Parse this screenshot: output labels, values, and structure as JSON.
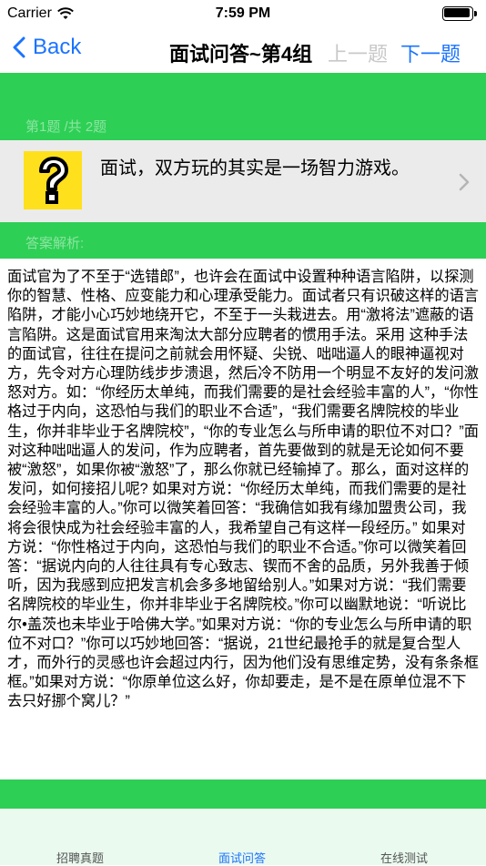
{
  "status": {
    "carrier": "Carrier",
    "time": "7:59 PM"
  },
  "nav": {
    "back_label": "Back",
    "title": "面试问答~第4组",
    "prev_label": "上一题",
    "next_label": "下一题"
  },
  "question": {
    "progress": "第1题 /共 2题",
    "text": "面试，双方玩的其实是一场智力游戏。",
    "icon": "question-mark-icon"
  },
  "answer": {
    "label": "答案解析:",
    "body": "面试官为了不至于“选错郎”，也许会在面试中设置种种语言陷阱，以探测你的智慧、性格、应变能力和心理承受能力。面试者只有识破这样的语言陷阱，才能小心巧妙地绕开它，不至于一头栽进去。用“激将法”遮蔽的语言陷阱。这是面试官用来淘汰大部分应聘者的惯用手法。采用 这种手法的面试官，往往在提问之前就会用怀疑、尖锐、咄咄逼人的眼神逼视对方，先令对方心理防线步步溃退，然后冷不防用一个明显不友好的发问激怒对方。如：“你经历太单纯，而我们需要的是社会经验丰富的人”，“你性格过于内向，这恐怕与我们的职业不合适”，“我们需要名牌院校的毕业生，你并非毕业于名牌院校”，“你的专业怎么与所申请的职位不对口？”面对这种咄咄逼人的发问，作为应聘者，首先要做到的就是无论如何不要被“激怒”，如果你被“激怒”了，那么你就已经输掉了。那么，面对这样的发问，如何接招儿呢? 如果对方说：“你经历太单纯，而我们需要的是社会经验丰富的人。”你可以微笑着回答：“我确信如我有缘加盟贵公司，我将会很快成为社会经验丰富的人，我希望自己有这样一段经历。” 如果对方说：“你性格过于内向，这恐怕与我们的职业不合适。”你可以微笑着回答：“据说内向的人往往具有专心致志、锲而不舍的品质，另外我善于倾听，因为我感到应把发言机会多多地留给别人。”如果对方说：“我们需要名牌院校的毕业生，你并非毕业于名牌院校。”你可以幽默地说：“听说比尔•盖茨也未毕业于哈佛大学。”如果对方说：“你的专业怎么与所申请的职位不对口？”你可以巧妙地回答：“据说，21世纪最抢手的就是复合型人才，而外行的灵感也许会超过内行，因为他们没有思维定势，没有条条框框。”如果对方说：“你原单位这么好，你却要走，是不是在原单位混不下去只好挪个窝儿？”"
  },
  "tabs": [
    {
      "label": "招聘真题",
      "active": false
    },
    {
      "label": "面试问答",
      "active": true
    },
    {
      "label": "在线测试",
      "active": false
    }
  ],
  "colors": {
    "accent_blue": "#1a73ff",
    "green": "#2ecf55",
    "disabled_gray": "#c8c8c8",
    "icon_yellow": "#ffe01c"
  }
}
